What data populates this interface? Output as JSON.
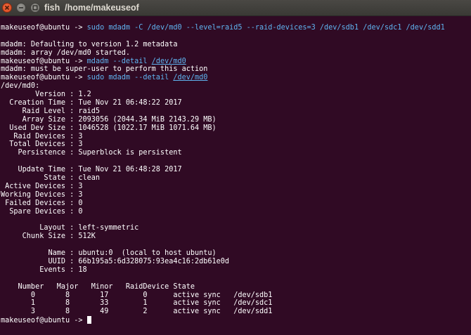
{
  "window": {
    "title": "fish  /home/makeuseof"
  },
  "terminal": {
    "prompt": "makeuseof@ubuntu -> ",
    "lines": [
      {
        "type": "cmd",
        "prompt": "makeuseof@ubuntu -> ",
        "command": "sudo mdadm -C /dev/md0 --level=raid5 --raid-devices=3 /dev/sdb1 /dev/sdc1 /dev/sdd1"
      },
      {
        "type": "text",
        "text": ""
      },
      {
        "type": "text",
        "text": "mdadm: Defaulting to version 1.2 metadata"
      },
      {
        "type": "text",
        "text": "mdadm: array /dev/md0 started."
      },
      {
        "type": "cmd",
        "prompt": "makeuseof@ubuntu -> ",
        "command": "mdadm --detail ",
        "path": "/dev/md0"
      },
      {
        "type": "text",
        "text": "mdadm: must be super-user to perform this action"
      },
      {
        "type": "cmd",
        "prompt": "makeuseof@ubuntu -> ",
        "command": "sudo mdadm --detail ",
        "path": "/dev/md0"
      },
      {
        "type": "text",
        "text": "/dev/md0:"
      },
      {
        "type": "text",
        "text": "        Version : 1.2"
      },
      {
        "type": "text",
        "text": "  Creation Time : Tue Nov 21 06:48:22 2017"
      },
      {
        "type": "text",
        "text": "     Raid Level : raid5"
      },
      {
        "type": "text",
        "text": "     Array Size : 2093056 (2044.34 MiB 2143.29 MB)"
      },
      {
        "type": "text",
        "text": "  Used Dev Size : 1046528 (1022.17 MiB 1071.64 MB)"
      },
      {
        "type": "text",
        "text": "   Raid Devices : 3"
      },
      {
        "type": "text",
        "text": "  Total Devices : 3"
      },
      {
        "type": "text",
        "text": "    Persistence : Superblock is persistent"
      },
      {
        "type": "text",
        "text": ""
      },
      {
        "type": "text",
        "text": "    Update Time : Tue Nov 21 06:48:28 2017"
      },
      {
        "type": "text",
        "text": "          State : clean"
      },
      {
        "type": "text",
        "text": " Active Devices : 3"
      },
      {
        "type": "text",
        "text": "Working Devices : 3"
      },
      {
        "type": "text",
        "text": " Failed Devices : 0"
      },
      {
        "type": "text",
        "text": "  Spare Devices : 0"
      },
      {
        "type": "text",
        "text": ""
      },
      {
        "type": "text",
        "text": "         Layout : left-symmetric"
      },
      {
        "type": "text",
        "text": "     Chunk Size : 512K"
      },
      {
        "type": "text",
        "text": ""
      },
      {
        "type": "text",
        "text": "           Name : ubuntu:0  (local to host ubuntu)"
      },
      {
        "type": "text",
        "text": "           UUID : 66b195a5:6d328075:93ea4c16:2db61e0d"
      },
      {
        "type": "text",
        "text": "         Events : 18"
      },
      {
        "type": "text",
        "text": ""
      },
      {
        "type": "text",
        "text": "    Number   Major   Minor   RaidDevice State"
      },
      {
        "type": "text",
        "text": "       0       8       17        0      active sync   /dev/sdb1"
      },
      {
        "type": "text",
        "text": "       1       8       33        1      active sync   /dev/sdc1"
      },
      {
        "type": "text",
        "text": "       3       8       49        2      active sync   /dev/sdd1"
      },
      {
        "type": "cmd",
        "prompt": "makeuseof@ubuntu -> ",
        "command": "",
        "cursor": true
      }
    ]
  }
}
